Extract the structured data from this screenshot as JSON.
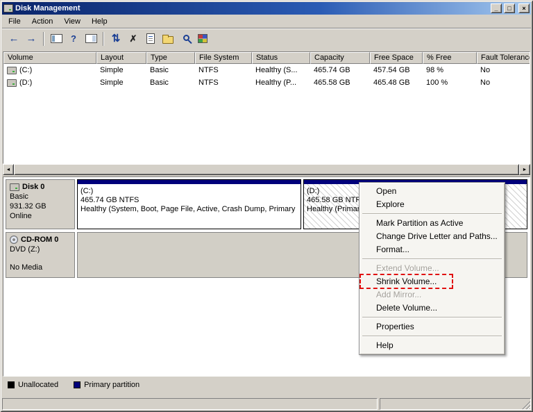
{
  "window": {
    "title": "Disk Management",
    "minimize_glyph": "_",
    "maximize_glyph": "□",
    "close_glyph": "×"
  },
  "menubar": {
    "items": [
      "File",
      "Action",
      "View",
      "Help"
    ]
  },
  "toolbar": {
    "back_glyph": "←",
    "forward_glyph": "→",
    "help_glyph": "?",
    "refresh_glyph": "⇅",
    "delete_glyph": "✗"
  },
  "volume_table": {
    "columns": [
      "Volume",
      "Layout",
      "Type",
      "File System",
      "Status",
      "Capacity",
      "Free Space",
      "% Free",
      "Fault Tolerance"
    ],
    "rows": [
      [
        "(C:)",
        "Simple",
        "Basic",
        "NTFS",
        "Healthy (S...",
        "465.74 GB",
        "457.54 GB",
        "98 %",
        "No"
      ],
      [
        "(D:)",
        "Simple",
        "Basic",
        "NTFS",
        "Healthy (P...",
        "465.58 GB",
        "465.48 GB",
        "100 %",
        "No"
      ]
    ]
  },
  "scrollbar": {
    "left_glyph": "◄",
    "right_glyph": "►"
  },
  "disks": {
    "disk0": {
      "name": "Disk 0",
      "type": "Basic",
      "size": "931.32 GB",
      "status": "Online"
    },
    "disk0_partitions": [
      {
        "label": "(C:)",
        "size": "465.74 GB NTFS",
        "status": "Healthy (System, Boot, Page File, Active, Crash Dump, Primary P"
      },
      {
        "label": "(D:)",
        "size": "465.58 GB NTFS",
        "status": "Healthy (Primary"
      }
    ],
    "cdrom0": {
      "name": "CD-ROM 0",
      "type": "DVD (Z:)",
      "status": "No Media"
    }
  },
  "context_menu": {
    "items": [
      {
        "label": "Open",
        "enabled": true
      },
      {
        "label": "Explore",
        "enabled": true
      },
      {
        "type": "separator"
      },
      {
        "label": "Mark Partition as Active",
        "enabled": true
      },
      {
        "label": "Change Drive Letter and Paths...",
        "enabled": true
      },
      {
        "label": "Format...",
        "enabled": true
      },
      {
        "type": "separator"
      },
      {
        "label": "Extend Volume...",
        "enabled": false
      },
      {
        "label": "Shrink Volume...",
        "enabled": true,
        "annotated": true
      },
      {
        "label": "Add Mirror...",
        "enabled": false
      },
      {
        "label": "Delete Volume...",
        "enabled": true
      },
      {
        "type": "separator"
      },
      {
        "label": "Properties",
        "enabled": true
      },
      {
        "type": "separator"
      },
      {
        "label": "Help",
        "enabled": true
      }
    ]
  },
  "legend": {
    "items": [
      {
        "label": "Unallocated",
        "color": "#000000"
      },
      {
        "label": "Primary partition",
        "color": "#00007b"
      }
    ]
  },
  "colors": {
    "titlebar_gradient_start": "#0a246a",
    "titlebar_gradient_end": "#a6caf0",
    "window_chrome": "#d4d0c8",
    "primary_partition": "#00007b",
    "unallocated": "#000000",
    "annotation_red": "#e01010"
  }
}
